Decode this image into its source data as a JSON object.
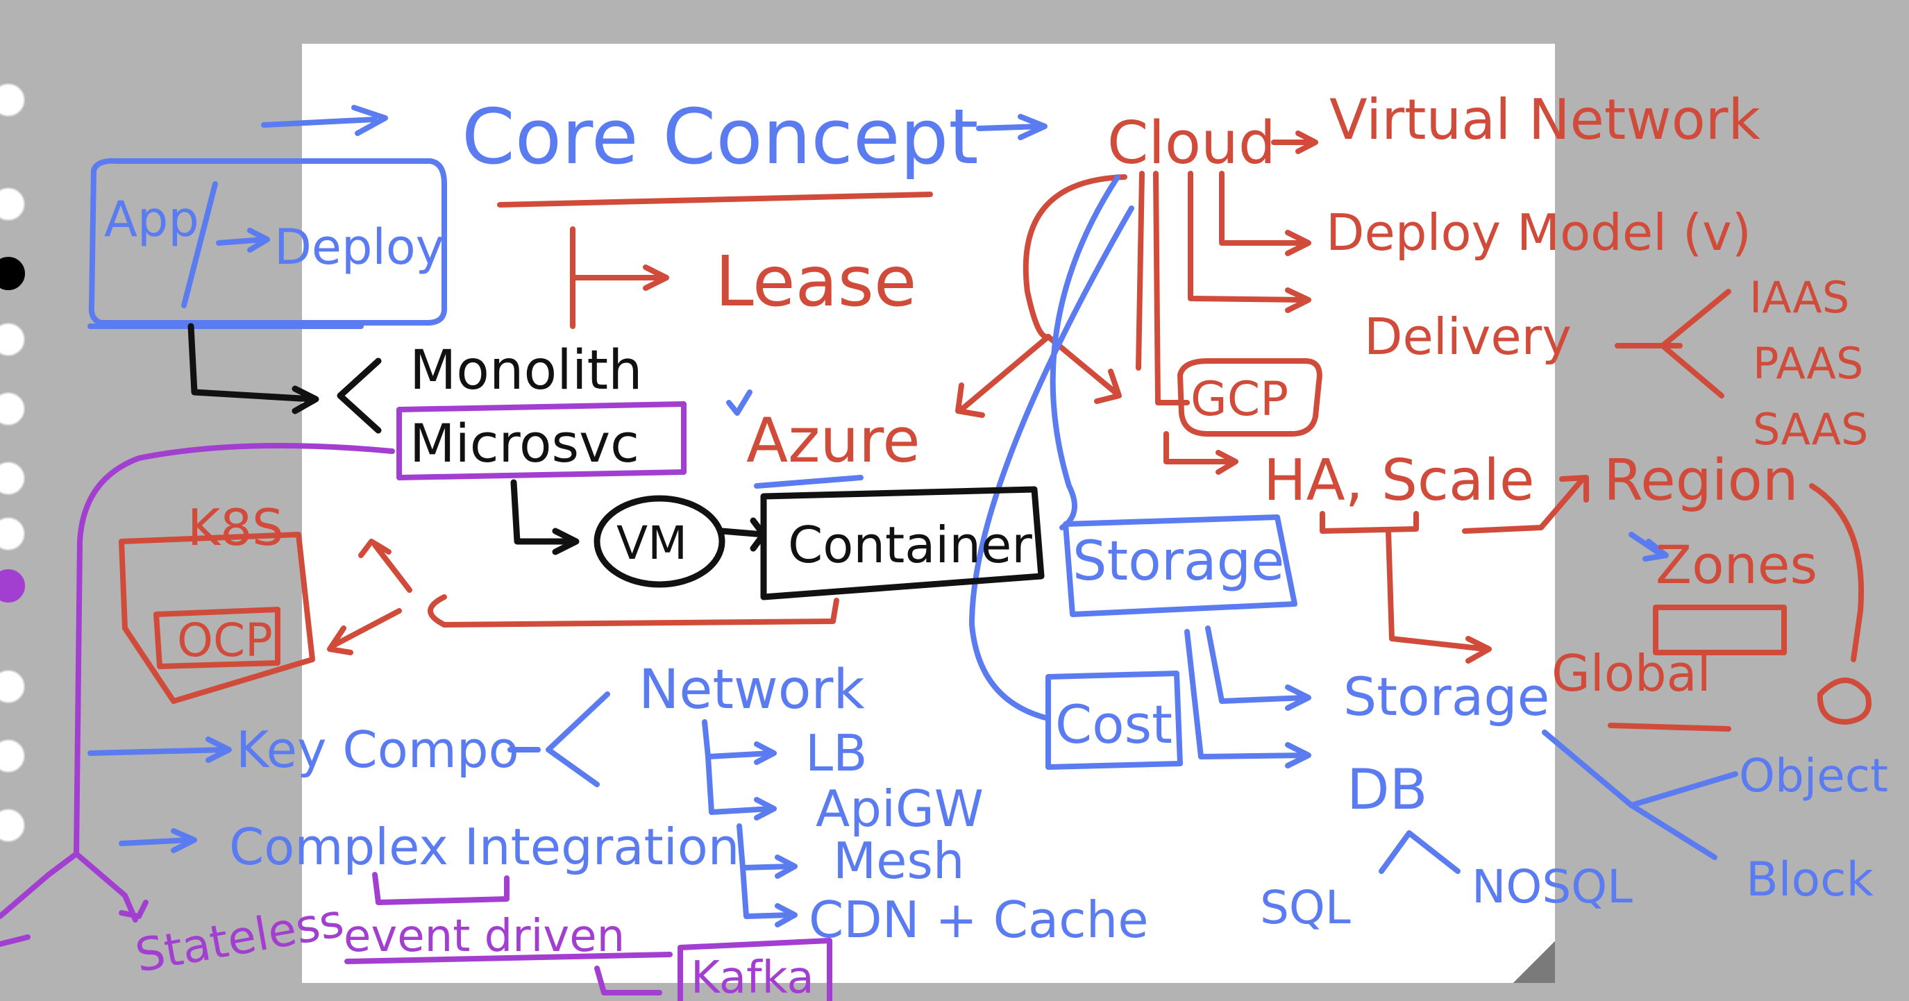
{
  "colors": {
    "background": "#b3b3b3",
    "paper": "#ffffff",
    "blue_ink": "#5b7cf0",
    "red_ink": "#d14b3a",
    "black_ink": "#111111",
    "purple_ink": "#a23fd0"
  },
  "left_toolbar": {
    "icons": [
      "pen-color-white",
      "pen-color-white",
      "pen-color-black",
      "pen-color-white",
      "pen-color-white",
      "pen-color-white",
      "pen-color-white",
      "pen-color-purple",
      "pen-color-white",
      "pen-color-white",
      "pen-color-white"
    ]
  },
  "notes": {
    "core_concept": "Core Concept",
    "lease": "Lease",
    "cloud": "Cloud",
    "virtual_network": "Virtual Network",
    "deploy_model": "Deploy Model (v)",
    "delivery": "Delivery",
    "iaas": "IAAS",
    "paas": "PAAS",
    "saas": "SAAS",
    "azure": "Azure",
    "gcp": "GCP",
    "ha_scale": "HA, Scale",
    "region": "Region",
    "zones": "Zones",
    "global": "Global",
    "app": "App",
    "deploy": "Deploy",
    "monolith": "Monolith",
    "microsvc": "Microsvc",
    "vm": "VM",
    "container": "Container",
    "k8s": "K8S",
    "ocp": "OCP",
    "storage_box": "Storage",
    "cost": "Cost",
    "storage": "Storage",
    "db": "DB",
    "sql": "SQL",
    "nosql": "NOSQL",
    "object": "Object",
    "block": "Block",
    "network": "Network",
    "lb": "LB",
    "apigw": "ApiGW",
    "mesh": "Mesh",
    "cdn_cache": "CDN + Cache",
    "key_compo": "Key Compo",
    "complex_integration": "Complex Integration",
    "stateless": "Stateless",
    "event_driven": "event driven",
    "kafka": "Kafka"
  }
}
